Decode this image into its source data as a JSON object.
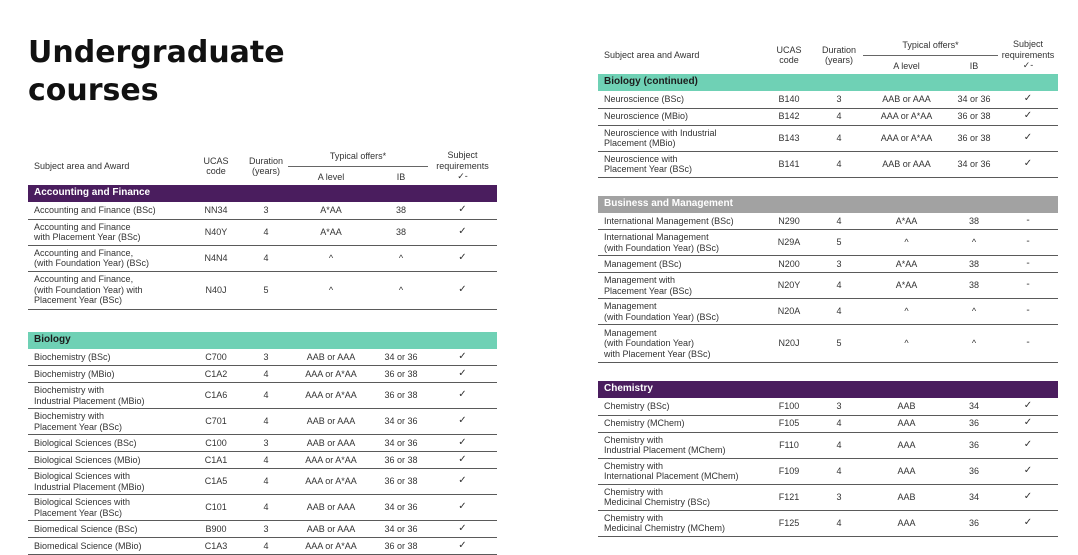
{
  "title_line1": "Undergraduate",
  "title_line2": "courses",
  "table_header": {
    "subject": "Subject area and Award",
    "ucas_line1": "UCAS",
    "ucas_line2": "code",
    "duration_line1": "Duration",
    "duration_line2": "(years)",
    "offers": "Typical offers*",
    "alevel": "A level",
    "ib": "IB",
    "req_line1": "Subject",
    "req_line2": "requirements",
    "req_line3": "✓-"
  },
  "left_sections": [
    {
      "name": "Accounting and Finance",
      "rows": [
        {
          "subject": "Accounting and Finance (BSc)",
          "code": "NN34",
          "duration": "3",
          "alevel": "A*AA",
          "ib": "38",
          "req": "✓"
        },
        {
          "subject": "Accounting and Finance\nwith Placement Year (BSc)",
          "code": "N40Y",
          "duration": "4",
          "alevel": "A*AA",
          "ib": "38",
          "req": "✓"
        },
        {
          "subject": "Accounting and Finance,\n(with Foundation Year) (BSc)",
          "code": "N4N4",
          "duration": "4",
          "alevel": "^",
          "ib": "^",
          "req": "✓"
        },
        {
          "subject": "Accounting and Finance,\n(with Foundation Year) with\nPlacement Year (BSc)",
          "code": "N40J",
          "duration": "5",
          "alevel": "^",
          "ib": "^",
          "req": "✓"
        }
      ]
    },
    {
      "name": "Biology",
      "rows": [
        {
          "subject": "Biochemistry (BSc)",
          "code": "C700",
          "duration": "3",
          "alevel": "AAB or AAA",
          "ib": "34 or 36",
          "req": "✓"
        },
        {
          "subject": "Biochemistry (MBio)",
          "code": "C1A2",
          "duration": "4",
          "alevel": "AAA or A*AA",
          "ib": "36 or 38",
          "req": "✓"
        },
        {
          "subject": "Biochemistry with\nIndustrial Placement (MBio)",
          "code": "C1A6",
          "duration": "4",
          "alevel": "AAA or A*AA",
          "ib": "36 or 38",
          "req": "✓"
        },
        {
          "subject": "Biochemistry with\nPlacement Year (BSc)",
          "code": "C701",
          "duration": "4",
          "alevel": "AAB or AAA",
          "ib": "34 or 36",
          "req": "✓"
        },
        {
          "subject": "Biological Sciences (BSc)",
          "code": "C100",
          "duration": "3",
          "alevel": "AAB or AAA",
          "ib": "34 or 36",
          "req": "✓"
        },
        {
          "subject": "Biological Sciences (MBio)",
          "code": "C1A1",
          "duration": "4",
          "alevel": "AAA or A*AA",
          "ib": "36 or 38",
          "req": "✓"
        },
        {
          "subject": "Biological Sciences with\nIndustrial Placement (MBio)",
          "code": "C1A5",
          "duration": "4",
          "alevel": "AAA or A*AA",
          "ib": "36 or 38",
          "req": "✓"
        },
        {
          "subject": "Biological Sciences with\nPlacement Year (BSc)",
          "code": "C101",
          "duration": "4",
          "alevel": "AAB or AAA",
          "ib": "34 or 36",
          "req": "✓"
        },
        {
          "subject": "Biomedical Science (BSc)",
          "code": "B900",
          "duration": "3",
          "alevel": "AAB or AAA",
          "ib": "34 or 36",
          "req": "✓"
        },
        {
          "subject": "Biomedical Science (MBio)",
          "code": "C1A3",
          "duration": "4",
          "alevel": "AAA or A*AA",
          "ib": "36 or 38",
          "req": "✓"
        }
      ]
    }
  ],
  "right_sections": [
    {
      "name": "Biology (continued)",
      "rows": [
        {
          "subject": "Neuroscience (BSc)",
          "code": "B140",
          "duration": "3",
          "alevel": "AAB or AAA",
          "ib": "34 or 36",
          "req": "✓"
        },
        {
          "subject": "Neuroscience (MBio)",
          "code": "B142",
          "duration": "4",
          "alevel": "AAA or A*AA",
          "ib": "36 or 38",
          "req": "✓"
        },
        {
          "subject": "Neuroscience with Industrial\nPlacement (MBio)",
          "code": "B143",
          "duration": "4",
          "alevel": "AAA or A*AA",
          "ib": "36 or 38",
          "req": "✓"
        },
        {
          "subject": "Neuroscience with\nPlacement Year (BSc)",
          "code": "B141",
          "duration": "4",
          "alevel": "AAB or AAA",
          "ib": "34 or 36",
          "req": "✓"
        }
      ]
    },
    {
      "name": "Business and Management",
      "rows": [
        {
          "subject": "International Management (BSc)",
          "code": "N290",
          "duration": "4",
          "alevel": "A*AA",
          "ib": "38",
          "req": "-"
        },
        {
          "subject": "International Management\n(with Foundation Year) (BSc)",
          "code": "N29A",
          "duration": "5",
          "alevel": "^",
          "ib": "^",
          "req": "-"
        },
        {
          "subject": "Management (BSc)",
          "code": "N200",
          "duration": "3",
          "alevel": "A*AA",
          "ib": "38",
          "req": "-"
        },
        {
          "subject": "Management with\nPlacement Year (BSc)",
          "code": "N20Y",
          "duration": "4",
          "alevel": "A*AA",
          "ib": "38",
          "req": "-"
        },
        {
          "subject": "Management\n(with Foundation Year) (BSc)",
          "code": "N20A",
          "duration": "4",
          "alevel": "^",
          "ib": "^",
          "req": "-"
        },
        {
          "subject": "Management\n(with Foundation Year)\nwith Placement Year (BSc)",
          "code": "N20J",
          "duration": "5",
          "alevel": "^",
          "ib": "^",
          "req": "-"
        }
      ]
    },
    {
      "name": "Chemistry",
      "rows": [
        {
          "subject": "Chemistry (BSc)",
          "code": "F100",
          "duration": "3",
          "alevel": "AAB",
          "ib": "34",
          "req": "✓"
        },
        {
          "subject": "Chemistry (MChem)",
          "code": "F105",
          "duration": "4",
          "alevel": "AAA",
          "ib": "36",
          "req": "✓"
        },
        {
          "subject": "Chemistry with\nIndustrial Placement (MChem)",
          "code": "F110",
          "duration": "4",
          "alevel": "AAA",
          "ib": "36",
          "req": "✓"
        },
        {
          "subject": "Chemistry with\nInternational Placement (MChem)",
          "code": "F109",
          "duration": "4",
          "alevel": "AAA",
          "ib": "36",
          "req": "✓"
        },
        {
          "subject": "Chemistry with\nMedicinal Chemistry (BSc)",
          "code": "F121",
          "duration": "3",
          "alevel": "AAB",
          "ib": "34",
          "req": "✓"
        },
        {
          "subject": "Chemistry with\nMedicinal Chemistry (MChem)",
          "code": "F125",
          "duration": "4",
          "alevel": "AAA",
          "ib": "36",
          "req": "✓"
        }
      ]
    }
  ],
  "colors": {
    "Accounting and Finance": "purple",
    "Biology": "teal",
    "Biology (continued)": "teal",
    "Business and Management": "grey",
    "Chemistry": "purple"
  }
}
